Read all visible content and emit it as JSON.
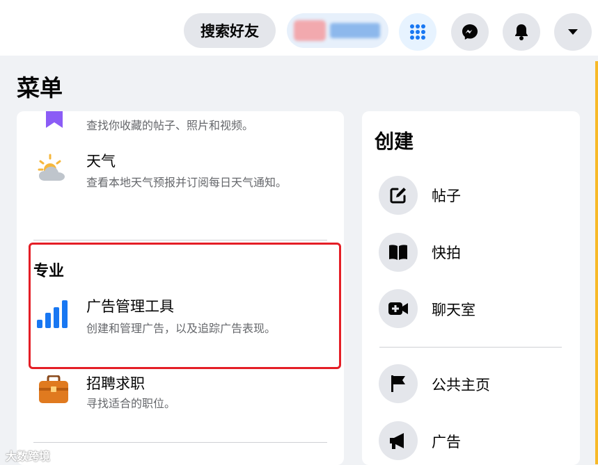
{
  "topbar": {
    "search_friends": "搜索好友",
    "icons": [
      "menu-grid-icon",
      "messenger-icon",
      "notifications-bell-icon",
      "account-caret-icon"
    ]
  },
  "menu": {
    "title": "菜单",
    "saved": {
      "desc": "查找你收藏的帖子、照片和视频。"
    },
    "weather": {
      "title": "天气",
      "desc": "查看本地天气预报并订阅每日天气通知。"
    },
    "professional": {
      "section_title": "专业",
      "ads_manager": {
        "title": "广告管理工具",
        "desc": "创建和管理广告，以及追踪广告表现。"
      }
    },
    "jobs": {
      "title": "招聘求职",
      "desc": "寻找适合的职位。"
    }
  },
  "create": {
    "title": "创建",
    "items": [
      {
        "label": "帖子",
        "icon": "compose-post-icon"
      },
      {
        "label": "快拍",
        "icon": "story-book-icon"
      },
      {
        "label": "聊天室",
        "icon": "video-room-icon"
      },
      {
        "label": "公共主页",
        "icon": "page-flag-icon"
      },
      {
        "label": "广告",
        "icon": "megaphone-icon"
      }
    ]
  },
  "watermark": "大数跨境",
  "colors": {
    "highlight": "#e41e26",
    "brand_blue": "#1877f2",
    "accent": "#f7b928"
  }
}
